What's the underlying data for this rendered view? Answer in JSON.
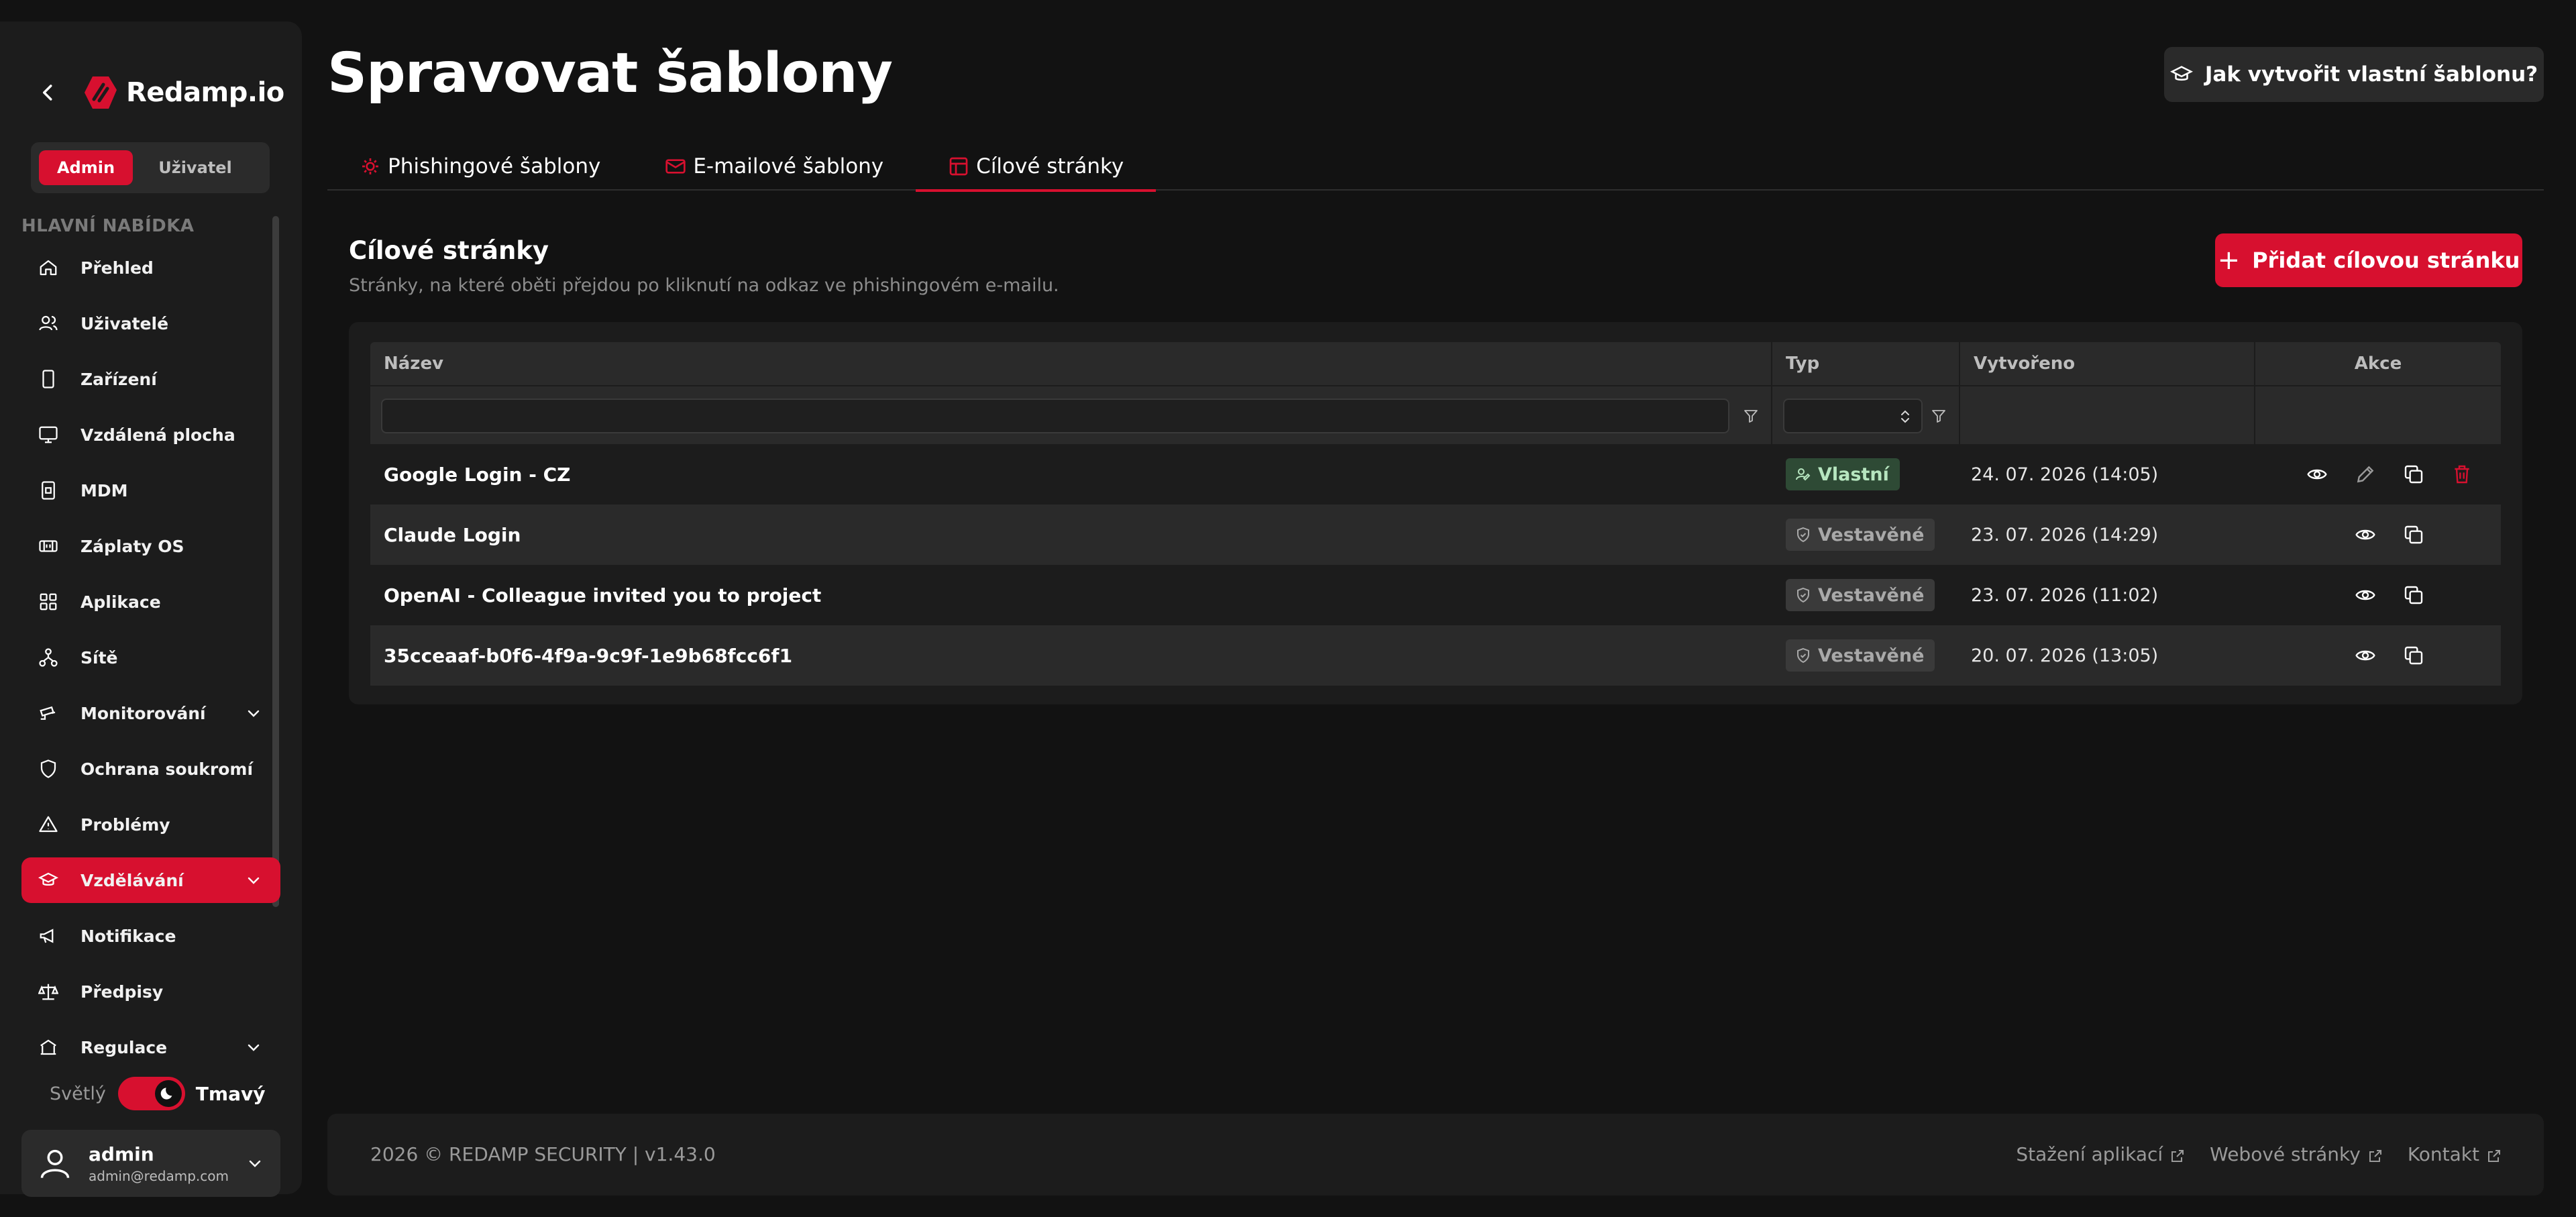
{
  "brand": {
    "name": "Redamp.io",
    "accent": "#d7102f"
  },
  "role_switch": {
    "admin": "Admin",
    "user": "Uživatel"
  },
  "sidebar": {
    "section_label": "HLAVNÍ NABÍDKA",
    "items": [
      {
        "label": "Přehled",
        "icon": "home-icon"
      },
      {
        "label": "Uživatelé",
        "icon": "users-icon"
      },
      {
        "label": "Zařízení",
        "icon": "device-icon"
      },
      {
        "label": "Vzdálená plocha",
        "icon": "monitor-icon"
      },
      {
        "label": "MDM",
        "icon": "mdm-icon"
      },
      {
        "label": "Záplaty OS",
        "icon": "patch-icon"
      },
      {
        "label": "Aplikace",
        "icon": "apps-icon"
      },
      {
        "label": "Sítě",
        "icon": "network-icon"
      },
      {
        "label": "Monitorování",
        "icon": "camera-icon"
      },
      {
        "label": "Ochrana soukromí",
        "icon": "shield-icon"
      },
      {
        "label": "Problémy",
        "icon": "warning-icon"
      },
      {
        "label": "Vzdělávání",
        "icon": "graduation-cap-icon"
      },
      {
        "label": "Notifikace",
        "icon": "megaphone-icon"
      },
      {
        "label": "Předpisy",
        "icon": "scales-icon"
      },
      {
        "label": "Regulace",
        "icon": "regulation-icon"
      }
    ]
  },
  "theme": {
    "light": "Světlý",
    "dark": "Tmavý"
  },
  "user": {
    "name": "admin",
    "email": "admin@redamp.com"
  },
  "page": {
    "title": "Spravovat šablony",
    "help_button": "Jak vytvořit vlastní šablonu?"
  },
  "tabs": [
    {
      "label": "Phishingové šablony",
      "icon": "phishing-icon"
    },
    {
      "label": "E-mailové šablony",
      "icon": "mail-icon"
    },
    {
      "label": "Cílové stránky",
      "icon": "layout-icon"
    }
  ],
  "section": {
    "title": "Cílové stránky",
    "subtitle": "Stránky, na které oběti přejdou po kliknutí na odkaz ve phishingovém e-mailu.",
    "add_button": "Přidat cílovou stránku"
  },
  "table": {
    "columns": [
      "Název",
      "Typ",
      "Vytvořeno",
      "Akce"
    ],
    "rows": [
      {
        "name": "Google Login - CZ",
        "type": "Vlastní",
        "created": "24. 07. 2026 (14:05)"
      },
      {
        "name": "Claude Login",
        "type": "Vestavěné",
        "created": "23. 07. 2026 (14:29)"
      },
      {
        "name": "OpenAI - Colleague invited you to project",
        "type": "Vestavěné",
        "created": "23. 07. 2026 (11:02)"
      },
      {
        "name": "35cceaaf-b0f6-4f9a-9c9f-1e9b68fcc6f1",
        "type": "Vestavěné",
        "created": "20. 07. 2026 (13:05)"
      }
    ]
  },
  "footer": {
    "copyright": "2026 © REDAMP SECURITY | v1.43.0",
    "links": [
      "Stažení aplikací",
      "Webové stránky",
      "Kontakt"
    ]
  }
}
